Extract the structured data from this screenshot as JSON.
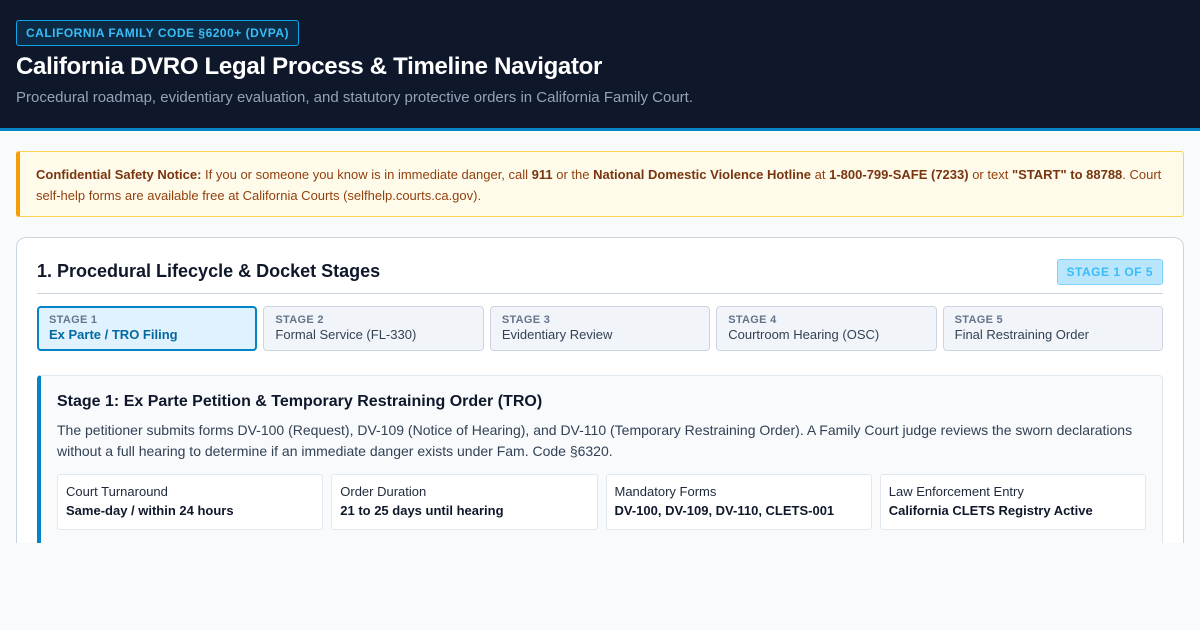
{
  "header": {
    "badge": "CALIFORNIA FAMILY CODE §6200+ (DVPA)",
    "title": "California DVRO Legal Process & Timeline Navigator",
    "subtitle": "Procedural roadmap, evidentiary evaluation, and statutory protective orders in California Family Court."
  },
  "notice": {
    "lead": "Confidential Safety Notice:",
    "text1": " If you or someone you know is in immediate danger, call ",
    "emergency": "911",
    "text2": " or the ",
    "hotline_name": "National Domestic Violence Hotline",
    "text3": " at ",
    "hotline_number": "1-800-799-SAFE (7233)",
    "text4": " or text ",
    "text_code": "\"START\" to 88788",
    "text5": ". Court self-help forms are available free at California Courts (selfhelp.courts.ca.gov)."
  },
  "lifecycle": {
    "title": "1. Procedural Lifecycle & Docket Stages",
    "counter": "STAGE 1 OF 5",
    "stages": [
      {
        "num": "STAGE 1",
        "label": "Ex Parte / TRO Filing"
      },
      {
        "num": "STAGE 2",
        "label": "Formal Service (FL-330)"
      },
      {
        "num": "STAGE 3",
        "label": "Evidentiary Review"
      },
      {
        "num": "STAGE 4",
        "label": "Courtroom Hearing (OSC)"
      },
      {
        "num": "STAGE 5",
        "label": "Final Restraining Order"
      }
    ],
    "active_index": 0
  },
  "detail": {
    "title": "Stage 1: Ex Parte Petition & Temporary Restraining Order (TRO)",
    "description": "The petitioner submits forms DV-100 (Request), DV-109 (Notice of Hearing), and DV-110 (Temporary Restraining Order). A Family Court judge reviews the sworn declarations without a full hearing to determine if an immediate danger exists under Fam. Code §6320.",
    "facts": [
      {
        "label": "Court Turnaround",
        "value": "Same-day / within 24 hours"
      },
      {
        "label": "Order Duration",
        "value": "21 to 25 days until hearing"
      },
      {
        "label": "Mandatory Forms",
        "value": "DV-100, DV-109, DV-110, CLETS-001"
      },
      {
        "label": "Law Enforcement Entry",
        "value": "California CLETS Registry Active"
      }
    ]
  },
  "colors": {
    "header_bg": "#0f172a",
    "accent": "#0284c7",
    "notice_bg": "#fffbeb",
    "notice_accent": "#f59e0b"
  }
}
